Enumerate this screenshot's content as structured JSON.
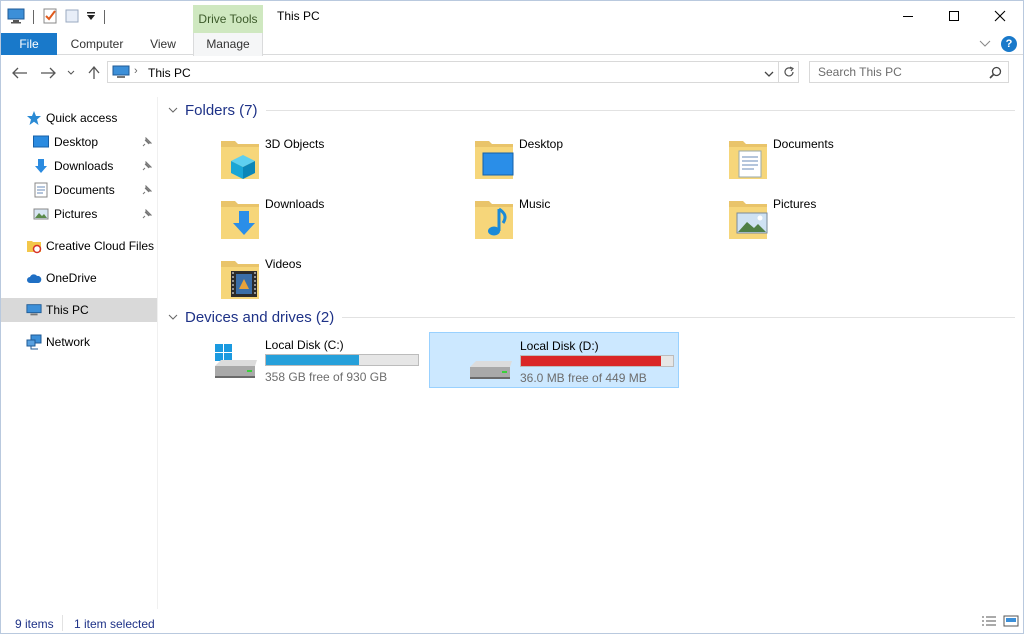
{
  "window": {
    "title": "This PC",
    "contextual_tab": "Drive Tools"
  },
  "ribbon": {
    "tabs": [
      {
        "label": "File"
      },
      {
        "label": "Computer"
      },
      {
        "label": "View"
      },
      {
        "label": "Manage"
      }
    ],
    "help": "?"
  },
  "address": {
    "path": "This PC",
    "search_placeholder": "Search This PC"
  },
  "nav": {
    "items": [
      {
        "label": "Quick access",
        "icon": "star-icon"
      },
      {
        "label": "Desktop",
        "icon": "desktop-icon",
        "pinned": true
      },
      {
        "label": "Downloads",
        "icon": "download-arrow-icon",
        "pinned": true
      },
      {
        "label": "Documents",
        "icon": "document-icon",
        "pinned": true
      },
      {
        "label": "Pictures",
        "icon": "pictures-icon",
        "pinned": true
      },
      {
        "label": "Creative Cloud Files",
        "icon": "creative-cloud-folder-icon"
      },
      {
        "label": "OneDrive",
        "icon": "cloud-icon"
      },
      {
        "label": "This PC",
        "icon": "computer-icon",
        "selected": true
      },
      {
        "label": "Network",
        "icon": "network-icon"
      }
    ]
  },
  "folders": {
    "header": "Folders (7)",
    "items": [
      {
        "name": "3D Objects",
        "icon": "3d-objects-folder-icon"
      },
      {
        "name": "Desktop",
        "icon": "desktop-folder-icon"
      },
      {
        "name": "Documents",
        "icon": "documents-folder-icon"
      },
      {
        "name": "Downloads",
        "icon": "downloads-folder-icon"
      },
      {
        "name": "Music",
        "icon": "music-folder-icon"
      },
      {
        "name": "Pictures",
        "icon": "pictures-folder-icon"
      },
      {
        "name": "Videos",
        "icon": "videos-folder-icon"
      }
    ]
  },
  "drives": {
    "header": "Devices and drives (2)",
    "items": [
      {
        "name": "Local Disk (C:)",
        "free_text": "358 GB free of 930 GB",
        "used_fraction": 0.615,
        "bar_color": "#26a0da",
        "icon": "windows-drive-icon",
        "selected": false
      },
      {
        "name": "Local Disk (D:)",
        "free_text": "36.0 MB free of 449 MB",
        "used_fraction": 0.92,
        "bar_color": "#da2626",
        "icon": "drive-icon",
        "selected": true
      }
    ]
  },
  "status": {
    "items_count": "9 items",
    "selection": "1 item selected"
  },
  "colors": {
    "accent": "#1979ca",
    "group_title": "#1e3287",
    "selection_bg": "#cce8ff",
    "contextual_tab_bg": "#cfe8c0"
  }
}
